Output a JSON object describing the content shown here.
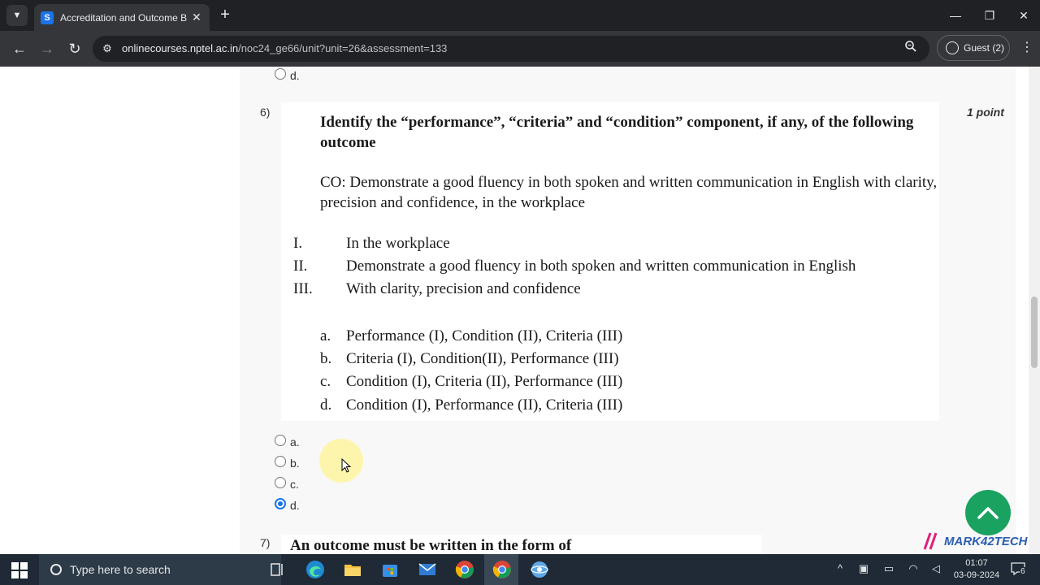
{
  "browser": {
    "tab_title": "Accreditation and Outcome Ba",
    "favicon_letter": "S",
    "close_glyph": "✕",
    "new_tab_glyph": "+",
    "url_host": "onlinecourses.nptel.ac.in",
    "url_path": "/noc24_ge66/unit?unit=26&assessment=133",
    "profile_label": "Guest (2)",
    "icons": [
      "tab-search-icon",
      "back-icon",
      "forward-icon",
      "reload-icon",
      "site-info-icon",
      "zoom-icon",
      "profile-icon",
      "menu-icon",
      "minimize-icon",
      "maximize-icon",
      "close-icon"
    ]
  },
  "prev_question": {
    "last_option_label": "d."
  },
  "question6": {
    "number": "6)",
    "points": "1 point",
    "title": "Identify the “performance”, “criteria” and “condition” component, if any, of the following outcome",
    "co_text": "CO: Demonstrate a good fluency in both spoken and written communication in English with clarity, precision and confidence, in the workplace",
    "items": [
      {
        "roman": "I.",
        "text": "In the workplace"
      },
      {
        "roman": "II.",
        "text": "Demonstrate a good fluency in both spoken and written communication in English"
      },
      {
        "roman": "III.",
        "text": "With clarity, precision and confidence"
      }
    ],
    "choices": [
      {
        "letter": "a.",
        "text": "Performance (I), Condition (II), Criteria (III)"
      },
      {
        "letter": "b.",
        "text": "Criteria (I), Condition(II), Performance (III)"
      },
      {
        "letter": "c.",
        "text": "Condition (I), Criteria (II), Performance (III)"
      },
      {
        "letter": "d.",
        "text": "Condition (I), Performance (II), Criteria (III)"
      }
    ],
    "options": [
      {
        "label": "a.",
        "checked": false
      },
      {
        "label": "b.",
        "checked": false
      },
      {
        "label": "c.",
        "checked": false
      },
      {
        "label": "d.",
        "checked": true
      }
    ]
  },
  "question7": {
    "number": "7)",
    "title": "An outcome must be written in the form of"
  },
  "overlay": {
    "scroll_top_icon": "chevron-up-icon",
    "watermark": "MARK42TECH"
  },
  "taskbar": {
    "search_placeholder": "Type here to search",
    "time": "01:07",
    "date": "03-09-2024",
    "notification_count": "6"
  },
  "colors": {
    "accent": "#1a73e8",
    "fab": "#1aa260",
    "watermark": "#2a5db0"
  }
}
